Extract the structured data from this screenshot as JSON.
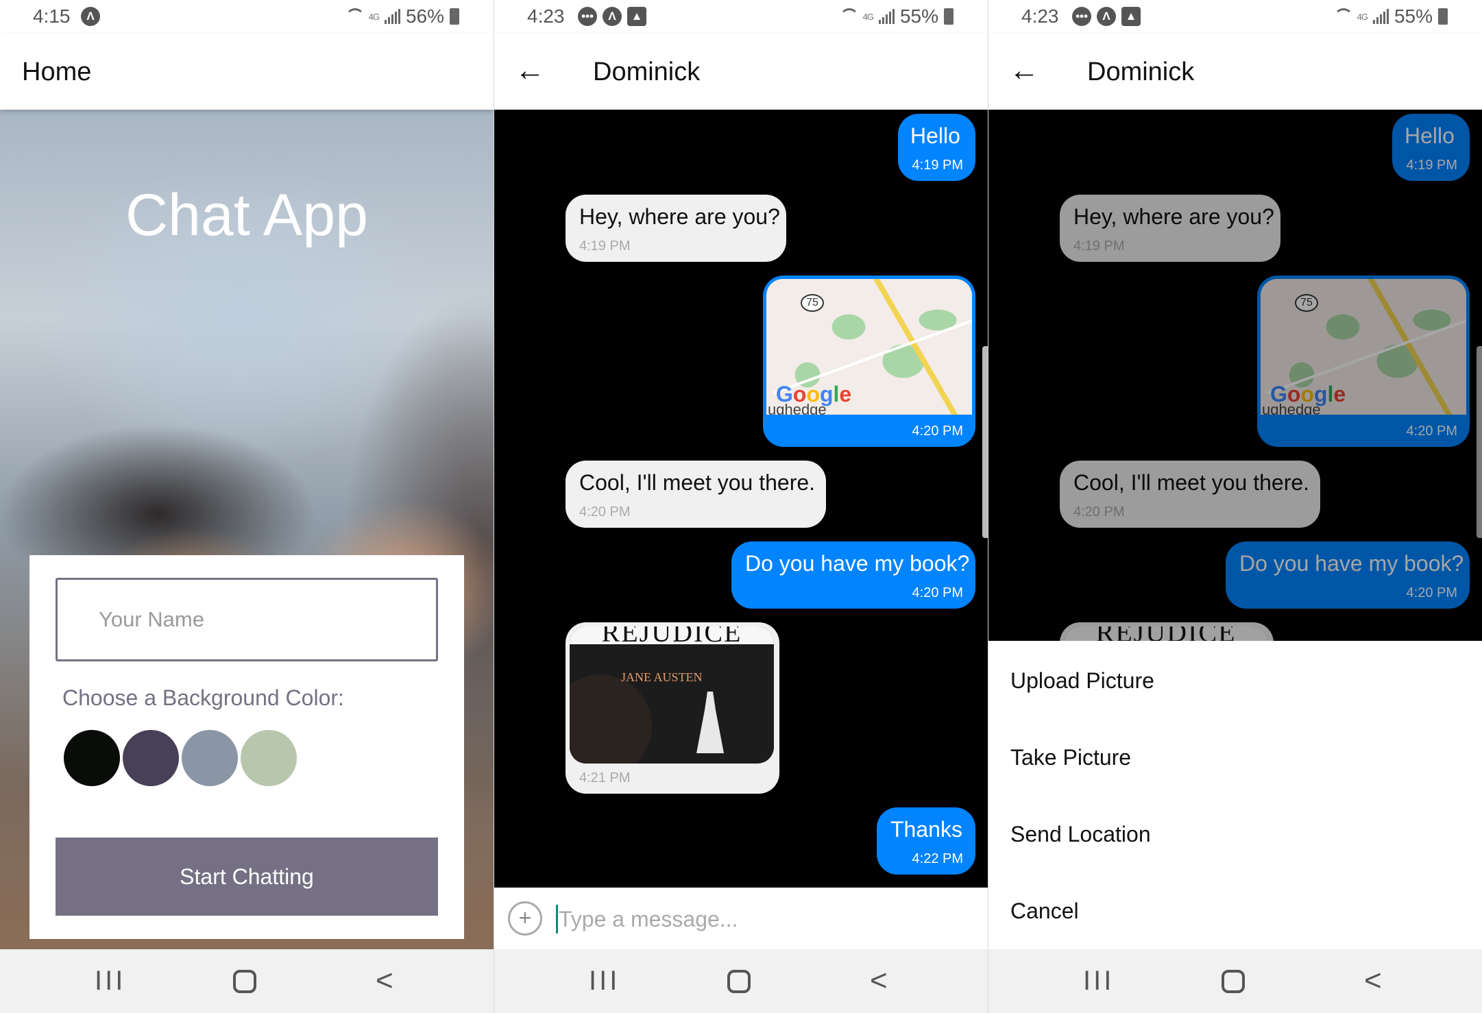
{
  "screen1": {
    "status": {
      "time": "4:15",
      "battery": "56%"
    },
    "header_title": "Home",
    "app_title": "Chat App",
    "name_placeholder": "Your Name",
    "color_label": "Choose a Background Color:",
    "colors": [
      "#090C08",
      "#474056",
      "#8A95A5",
      "#B9C6AE"
    ],
    "button": "Start Chatting"
  },
  "screen2": {
    "status": {
      "time": "4:23",
      "battery": "55%"
    },
    "header_title": "Dominick",
    "messages": [
      {
        "side": "right",
        "text": "Hello",
        "time": "4:19 PM"
      },
      {
        "side": "left",
        "text": "Hey, where are you?",
        "time": "4:19 PM"
      },
      {
        "side": "right",
        "type": "map",
        "time": "4:20 PM",
        "map_shield": "75",
        "map_logo": "Google",
        "map_place": "ughedge"
      },
      {
        "side": "left",
        "text": "Cool, I'll meet you there.",
        "time": "4:20 PM"
      },
      {
        "side": "right",
        "text": "Do you have my book?",
        "time": "4:20 PM"
      },
      {
        "side": "left",
        "type": "image",
        "time": "4:21 PM",
        "image_title": "REJUDICE",
        "image_author": "JANE AUSTEN"
      },
      {
        "side": "right",
        "text": "Thanks",
        "time": "4:22 PM"
      }
    ],
    "composer_placeholder": "Type a message..."
  },
  "screen3": {
    "status": {
      "time": "4:23",
      "battery": "55%"
    },
    "header_title": "Dominick",
    "messages": [
      {
        "side": "right",
        "text": "Hello",
        "time": "4:19 PM"
      },
      {
        "side": "left",
        "text": "Hey, where are you?",
        "time": "4:19 PM"
      },
      {
        "side": "right",
        "type": "map",
        "time": "4:20 PM",
        "map_shield": "75",
        "map_logo": "Google",
        "map_place": "ughedge"
      },
      {
        "side": "left",
        "text": "Cool, I'll meet you there.",
        "time": "4:20 PM"
      },
      {
        "side": "right",
        "text": "Do you have my book?",
        "time": "4:20 PM"
      },
      {
        "side": "left",
        "type": "image",
        "image_title": "REJUDICE"
      }
    ],
    "action_sheet": [
      "Upload Picture",
      "Take Picture",
      "Send Location",
      "Cancel"
    ]
  }
}
